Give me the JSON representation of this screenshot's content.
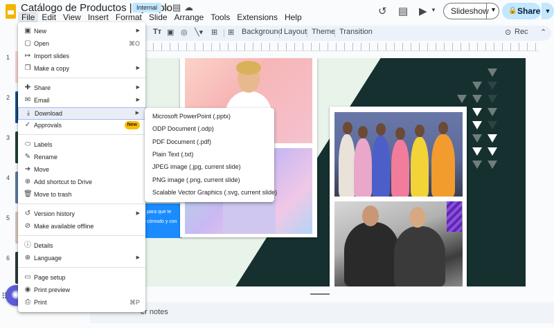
{
  "header": {
    "doc_title": "Catálogo de Productos | Ejemplo",
    "badge": "Internal",
    "star_icon": "star-icon",
    "move_icon": "folder-move-icon",
    "cloud_icon": "cloud-status-icon"
  },
  "menubar": {
    "items": [
      "File",
      "Edit",
      "View",
      "Insert",
      "Format",
      "Slide",
      "Arrange",
      "Tools",
      "Extensions",
      "Help"
    ]
  },
  "actions": {
    "slideshow": "Slideshow",
    "share": "Share"
  },
  "toolbar": {
    "background": "Background",
    "layout": "Layout",
    "theme": "Theme",
    "transition": "Transition",
    "rec": "Rec"
  },
  "filmstrip": {
    "slide_numbers": [
      "1",
      "2",
      "3",
      "4",
      "5",
      "6"
    ]
  },
  "canvas": {
    "blue_strip_text_1": "para que te",
    "blue_strip_text_2": "cómodo y con"
  },
  "notes": {
    "label": "er notes"
  },
  "file_menu": {
    "items": [
      {
        "icon": "new-icon",
        "glyph": "▣",
        "label": "New",
        "submenu": true
      },
      {
        "icon": "open-icon",
        "glyph": "▢",
        "label": "Open",
        "shortcut": "⌘O"
      },
      {
        "icon": "import-icon",
        "glyph": "↦",
        "label": "Import slides"
      },
      {
        "icon": "copy-icon",
        "glyph": "❐",
        "label": "Make a copy",
        "submenu": true
      },
      {
        "icon": "share-icon",
        "glyph": "✚",
        "label": "Share",
        "submenu": true
      },
      {
        "icon": "email-icon",
        "glyph": "✉",
        "label": "Email",
        "submenu": true
      },
      {
        "icon": "download-icon",
        "glyph": "⤓",
        "label": "Download",
        "submenu": true
      },
      {
        "icon": "approvals-icon",
        "glyph": "✓",
        "label": "Approvals",
        "badge": "New"
      },
      {
        "icon": "labels-icon",
        "glyph": "⬭",
        "label": "Labels"
      },
      {
        "icon": "rename-icon",
        "glyph": "✎",
        "label": "Rename"
      },
      {
        "icon": "move-icon",
        "glyph": "➜",
        "label": "Move"
      },
      {
        "icon": "shortcut-icon",
        "glyph": "⊕",
        "label": "Add shortcut to Drive"
      },
      {
        "icon": "trash-icon",
        "glyph": "🗑",
        "label": "Move to trash"
      },
      {
        "icon": "history-icon",
        "glyph": "↺",
        "label": "Version history",
        "submenu": true
      },
      {
        "icon": "offline-icon",
        "glyph": "⊘",
        "label": "Make available offline"
      },
      {
        "icon": "details-icon",
        "glyph": "ⓘ",
        "label": "Details"
      },
      {
        "icon": "language-icon",
        "glyph": "⊕",
        "label": "Language",
        "submenu": true
      },
      {
        "icon": "page-setup-icon",
        "glyph": "▭",
        "label": "Page setup"
      },
      {
        "icon": "print-preview-icon",
        "glyph": "◉",
        "label": "Print preview"
      },
      {
        "icon": "print-icon",
        "glyph": "⎙",
        "label": "Print",
        "shortcut": "⌘P"
      }
    ]
  },
  "download_menu": {
    "items": [
      "Microsoft PowerPoint (.pptx)",
      "ODP Document (.odp)",
      "PDF Document (.pdf)",
      "Plain Text (.txt)",
      "JPEG image (.jpg, current slide)",
      "PNG image (.png, current slide)",
      "Scalable Vector Graphics (.svg, current slide)"
    ]
  },
  "colors": {
    "accent": "#0b57d0",
    "share_bg": "#c2e7ff",
    "slide_dark": "#15302f",
    "slide_light": "#e8f3ea",
    "new_badge": "#fbbc04"
  }
}
